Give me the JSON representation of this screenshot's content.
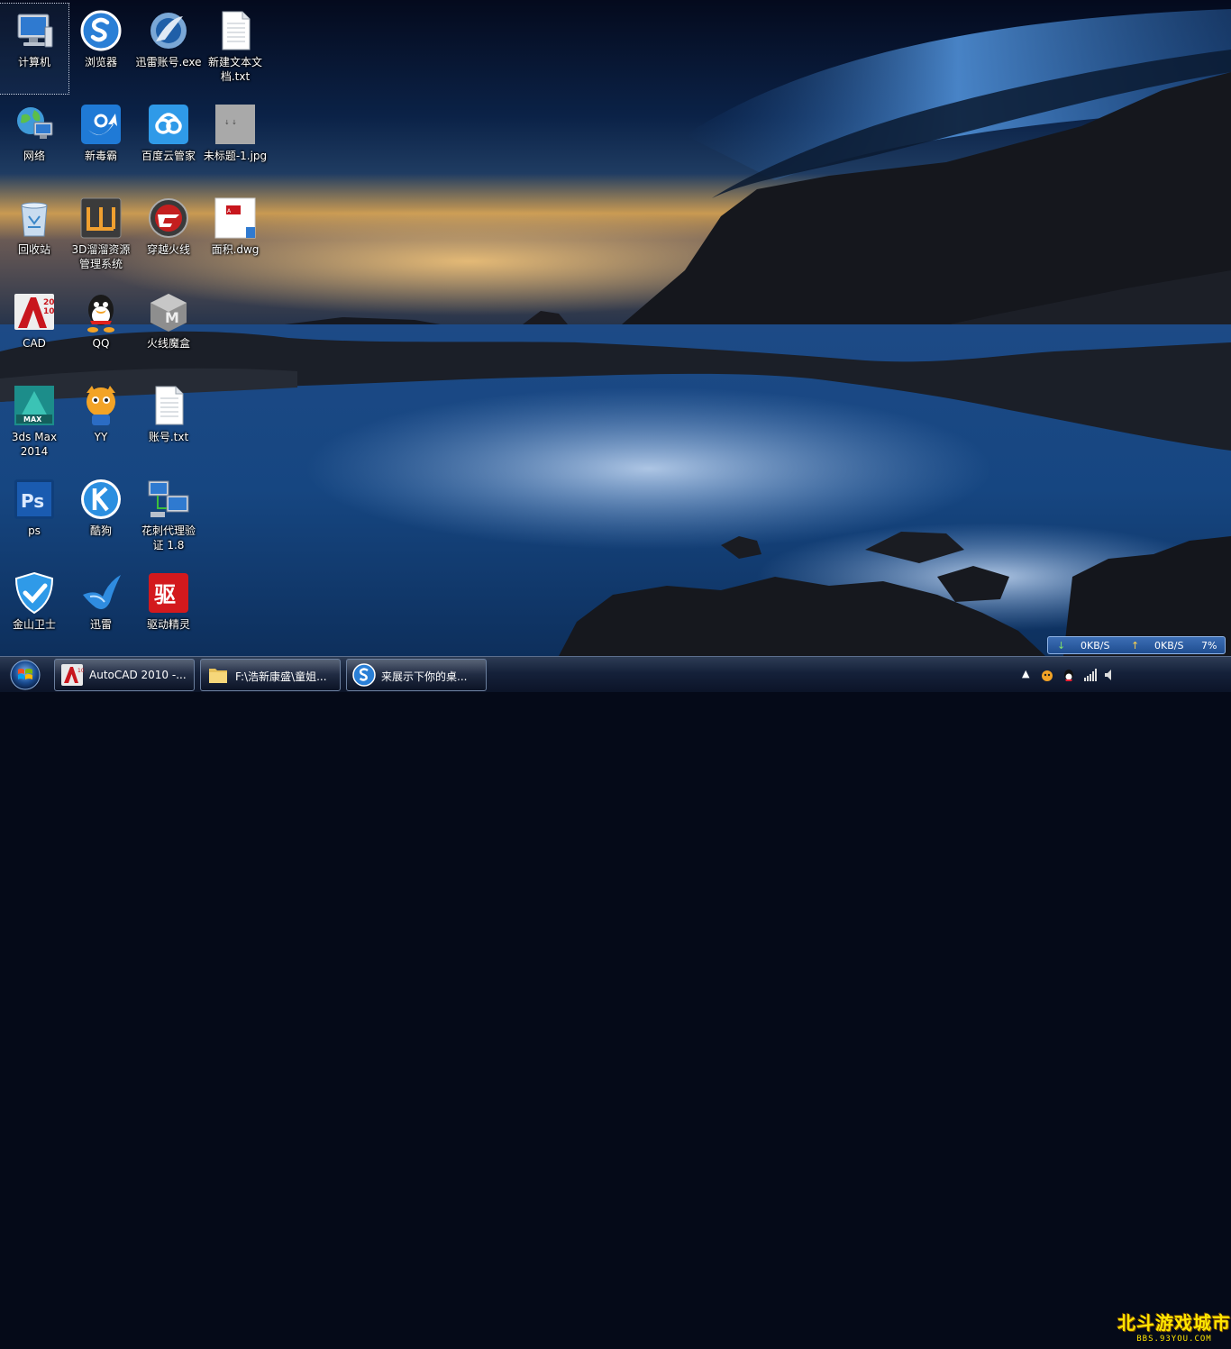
{
  "desktop": {
    "icons": [
      {
        "label": "计算机",
        "icon": "computer-icon"
      },
      {
        "label": "浏览器",
        "icon": "sogou-browser-icon"
      },
      {
        "label": "迅雷账号.exe",
        "icon": "xunlei-exe-icon"
      },
      {
        "label": "新建文本文\n档.txt",
        "icon": "text-file-icon"
      },
      {
        "label": "网络",
        "icon": "network-icon"
      },
      {
        "label": "新毒霸",
        "icon": "duba-icon"
      },
      {
        "label": "百度云管家",
        "icon": "baidu-cloud-icon"
      },
      {
        "label": "未标题-1.jpg",
        "icon": "image-file-icon"
      },
      {
        "label": "回收站",
        "icon": "recycle-bin-icon"
      },
      {
        "label": "3D溜溜资源\n管理系统",
        "icon": "3d-liuliu-icon"
      },
      {
        "label": "穿越火线",
        "icon": "crossfire-icon"
      },
      {
        "label": "面积.dwg",
        "icon": "dwg-file-icon"
      },
      {
        "label": "CAD",
        "icon": "autocad-icon"
      },
      {
        "label": "QQ",
        "icon": "qq-icon"
      },
      {
        "label": "火线魔盒",
        "icon": "mohe-icon"
      },
      {
        "label": "3ds Max\n2014",
        "icon": "3dsmax-icon"
      },
      {
        "label": "YY",
        "icon": "yy-icon"
      },
      {
        "label": "账号.txt",
        "icon": "text-file-icon"
      },
      {
        "label": "ps",
        "icon": "photoshop-icon"
      },
      {
        "label": "酷狗",
        "icon": "kugou-icon"
      },
      {
        "label": "花刺代理验\n证 1.8",
        "icon": "proxy-tool-icon"
      },
      {
        "label": "金山卫士",
        "icon": "kingsoft-guard-icon"
      },
      {
        "label": "迅雷",
        "icon": "xunlei-icon"
      },
      {
        "label": "驱动精灵",
        "icon": "driver-genius-icon"
      }
    ]
  },
  "taskbar": {
    "tasks": [
      {
        "label": "AutoCAD 2010 -...",
        "icon": "autocad-icon"
      },
      {
        "label": "F:\\浩新康盛\\童姐...",
        "icon": "folder-icon"
      },
      {
        "label": "来展示下你的桌...",
        "icon": "sogou-browser-icon"
      }
    ]
  },
  "network_monitor": {
    "download": "0KB/S",
    "upload": "0KB/S",
    "cpu": "7%"
  },
  "watermark": {
    "title": "北斗游戏城市",
    "url": "BBS.93YOU.COM"
  },
  "colors": {
    "taskbar": "#15213a",
    "netmon": "#2a5ca3"
  }
}
